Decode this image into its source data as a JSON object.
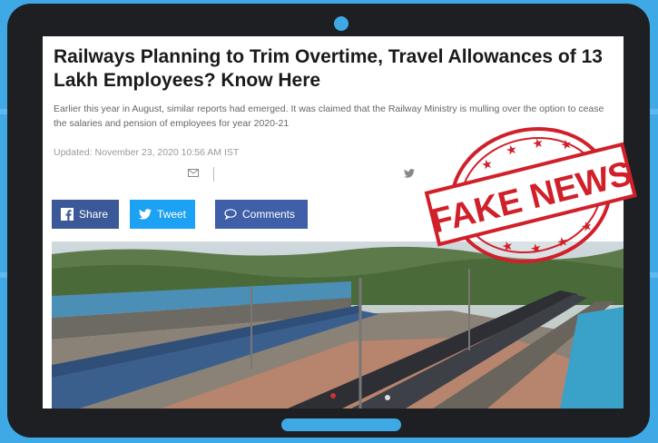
{
  "article": {
    "headline": "Railways Planning to Trim Overtime, Travel Allowances of 13 Lakh Employees? Know Here",
    "summary": "Earlier this year in August, similar reports had emerged. It was claimed that the Railway Ministry is mulling over the option to cease the salaries and pension of employees for year 2020-21",
    "updated": "Updated: November 23, 2020 10:56 AM IST"
  },
  "share_bar": {
    "share_label": "Share",
    "tweet_label": "Tweet",
    "comments_label": "Comments",
    "share_color": "#3b5998",
    "tweet_color": "#1da1f2",
    "comments_color": "#3f5fa8"
  },
  "stamp": {
    "text": "FAKE NEWS",
    "color": "#d0202a"
  },
  "icons": [
    "mail-icon",
    "twitter-icon",
    "facebook-icon",
    "comment-icon",
    "star-icon"
  ],
  "colors": {
    "background": "#3fa9e6",
    "device": "#1e1f22"
  }
}
